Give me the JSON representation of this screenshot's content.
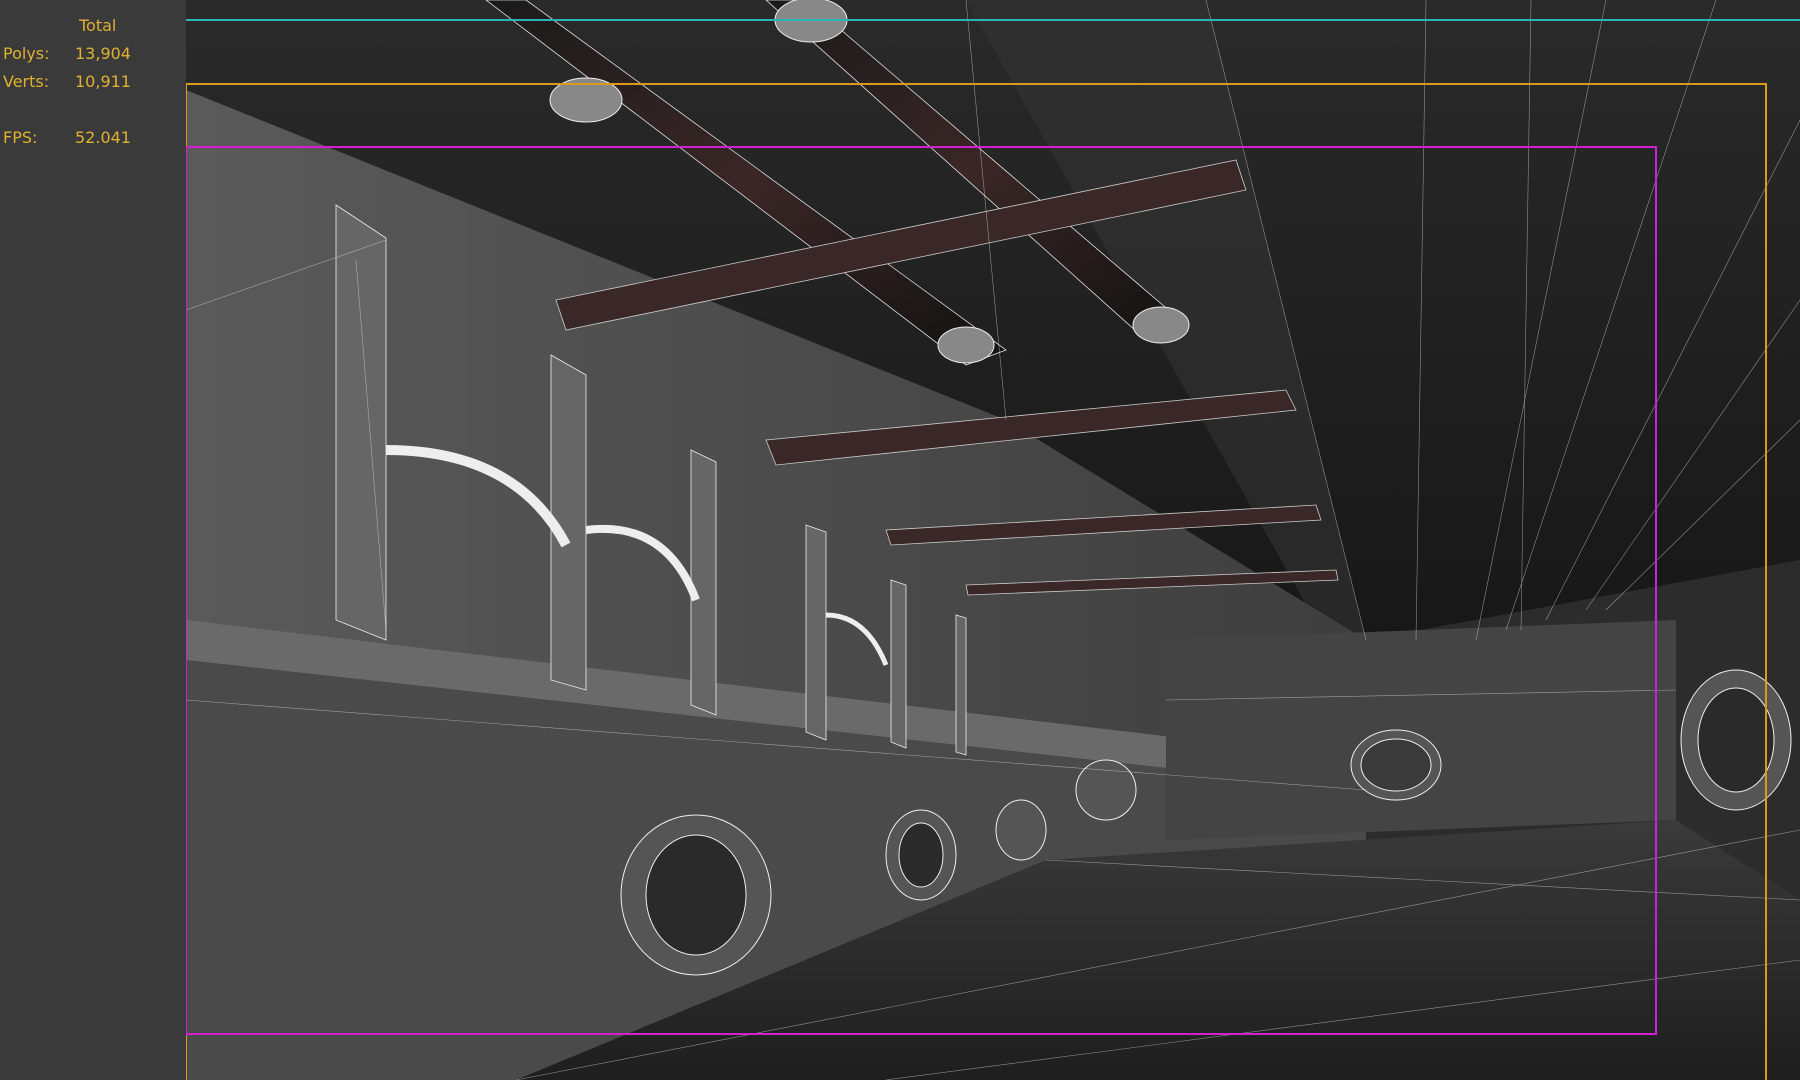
{
  "stats": {
    "header": "Total",
    "rows": [
      {
        "label": "Polys:",
        "value": "13,904"
      },
      {
        "label": "Verts:",
        "value": "10,911"
      },
      {
        "label": "FPS:",
        "value": "52.041"
      }
    ]
  },
  "colors": {
    "stat_text": "#e0b030",
    "safe_frame_outer": "#2ab5b5",
    "safe_frame_action": "#d99a1e",
    "safe_frame_title": "#d020d0",
    "panel_bg": "#3a3a3a"
  },
  "viewport": {
    "mode": "wireframe-over-shaded"
  }
}
